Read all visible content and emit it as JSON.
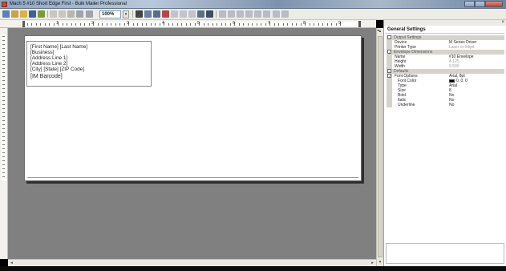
{
  "window": {
    "title": "Mach 5 #10 Short Edge First - Bulk Mailer Professional",
    "minimize_icon": "minimize-icon",
    "maximize_icon": "maximize-icon",
    "close_icon": "close-icon"
  },
  "toolbar": {
    "zoom_value": "100%"
  },
  "ruler": {
    "labels": [
      "1",
      "2",
      "3",
      "4",
      "5",
      "6",
      "7",
      "8",
      "9"
    ]
  },
  "envelope": {
    "address_lines": [
      "[First Name] [Last Name]",
      "[Business]",
      "[Address Line 1]",
      "[Address Line 2]",
      "[City] [State] [ZIP Code]"
    ],
    "barcode_line": "[IM Barcode]"
  },
  "panel": {
    "header": "General Settings",
    "close_glyph": "×",
    "rows": [
      {
        "type": "cat",
        "label": "Output Settings",
        "box": "-"
      },
      {
        "type": "prop",
        "label": "Device",
        "value": "M Series Driver"
      },
      {
        "type": "prop",
        "label": "Printer Type",
        "value": "Laser or Inkjet",
        "muted": true
      },
      {
        "type": "cat",
        "label": "Envelope Dimensions",
        "box": "-"
      },
      {
        "type": "prop",
        "label": "Name",
        "value": "#10 Envelope"
      },
      {
        "type": "prop",
        "label": "Height",
        "value": "4.125",
        "muted": true
      },
      {
        "type": "prop",
        "label": "Width",
        "value": "9.500",
        "muted": true
      },
      {
        "type": "cat",
        "label": "Defaults",
        "box": "-"
      },
      {
        "type": "prop",
        "label": "Font Options",
        "value": "Arial, 8pt",
        "box": "-"
      },
      {
        "type": "sub",
        "label": "Font Color",
        "value": "0, 0, 0",
        "swatch": "#000000"
      },
      {
        "type": "sub",
        "label": "Type",
        "value": "Arial"
      },
      {
        "type": "sub",
        "label": "Size",
        "value": "8"
      },
      {
        "type": "sub",
        "label": "Bold",
        "value": "No"
      },
      {
        "type": "sub",
        "label": "Italic",
        "value": "No"
      },
      {
        "type": "sub",
        "label": "Underline",
        "value": "No"
      }
    ]
  },
  "colors": {
    "canvas": "#808080",
    "paper": "#ffffff",
    "category_row": "#d6d3ca"
  }
}
